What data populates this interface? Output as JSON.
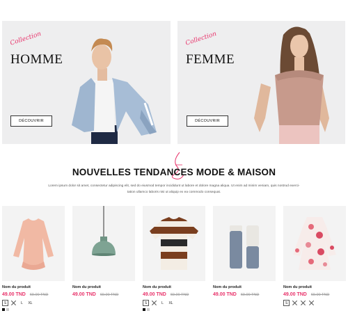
{
  "banners": {
    "homme": {
      "script": "Collection",
      "title": "HOMME",
      "button": "DÉCOUVRIR"
    },
    "femme": {
      "script": "Collection",
      "title": "FEMME",
      "button": "DÉCOUVRIR"
    }
  },
  "section": {
    "title": "NOUVELLES TENDANCES MODE & MAISON",
    "description_line1": "Lorem ipsum dolor sit amet, consectetur adipiscing elit, sed do eiusmod tempor incididunt ut labore et dolore magna aliqua. Ut enim ad minim veniam, quis nostrud exerci-",
    "description_line2": "tation ullamco laboris nisi ut aliquip ex ea commodo consequat."
  },
  "products": [
    {
      "name": "Nom du produit",
      "price": "49.00 TND",
      "old_price": "69.00 TND",
      "image_icon": "blouse-icon",
      "sizes": [
        {
          "label": "S"
        },
        {
          "label": "M"
        },
        {
          "label": "L"
        },
        {
          "label": "XL"
        }
      ],
      "swatches": [
        "#111111",
        "#cccccc"
      ]
    },
    {
      "name": "Nom du produit",
      "price": "49.00 TND",
      "old_price": "69.00 TND",
      "image_icon": "pendant-lamp-icon"
    },
    {
      "name": "Nom du produit",
      "price": "49.00 TND",
      "old_price": "69.00 TND",
      "image_icon": "striped-tshirt-icon",
      "sizes": [
        {
          "label": "S"
        },
        {
          "label": "M"
        },
        {
          "label": "L"
        },
        {
          "label": "XL"
        }
      ],
      "swatches": [
        "#111111",
        "#cccccc"
      ]
    },
    {
      "name": "Nom du produit",
      "price": "49.00 TND",
      "old_price": "69.00 TND",
      "image_icon": "grinder-set-icon"
    },
    {
      "name": "Nom du produit",
      "price": "49.00 TND",
      "old_price": "69.00 TND",
      "image_icon": "floral-dress-icon",
      "sizes": [
        {
          "label": "S"
        },
        {
          "label": "M"
        },
        {
          "label": "L"
        },
        {
          "label": "XL"
        }
      ]
    }
  ],
  "colors": {
    "accent": "#e8336b",
    "banner_bg": "#eeeeef",
    "old_price": "#999999"
  }
}
